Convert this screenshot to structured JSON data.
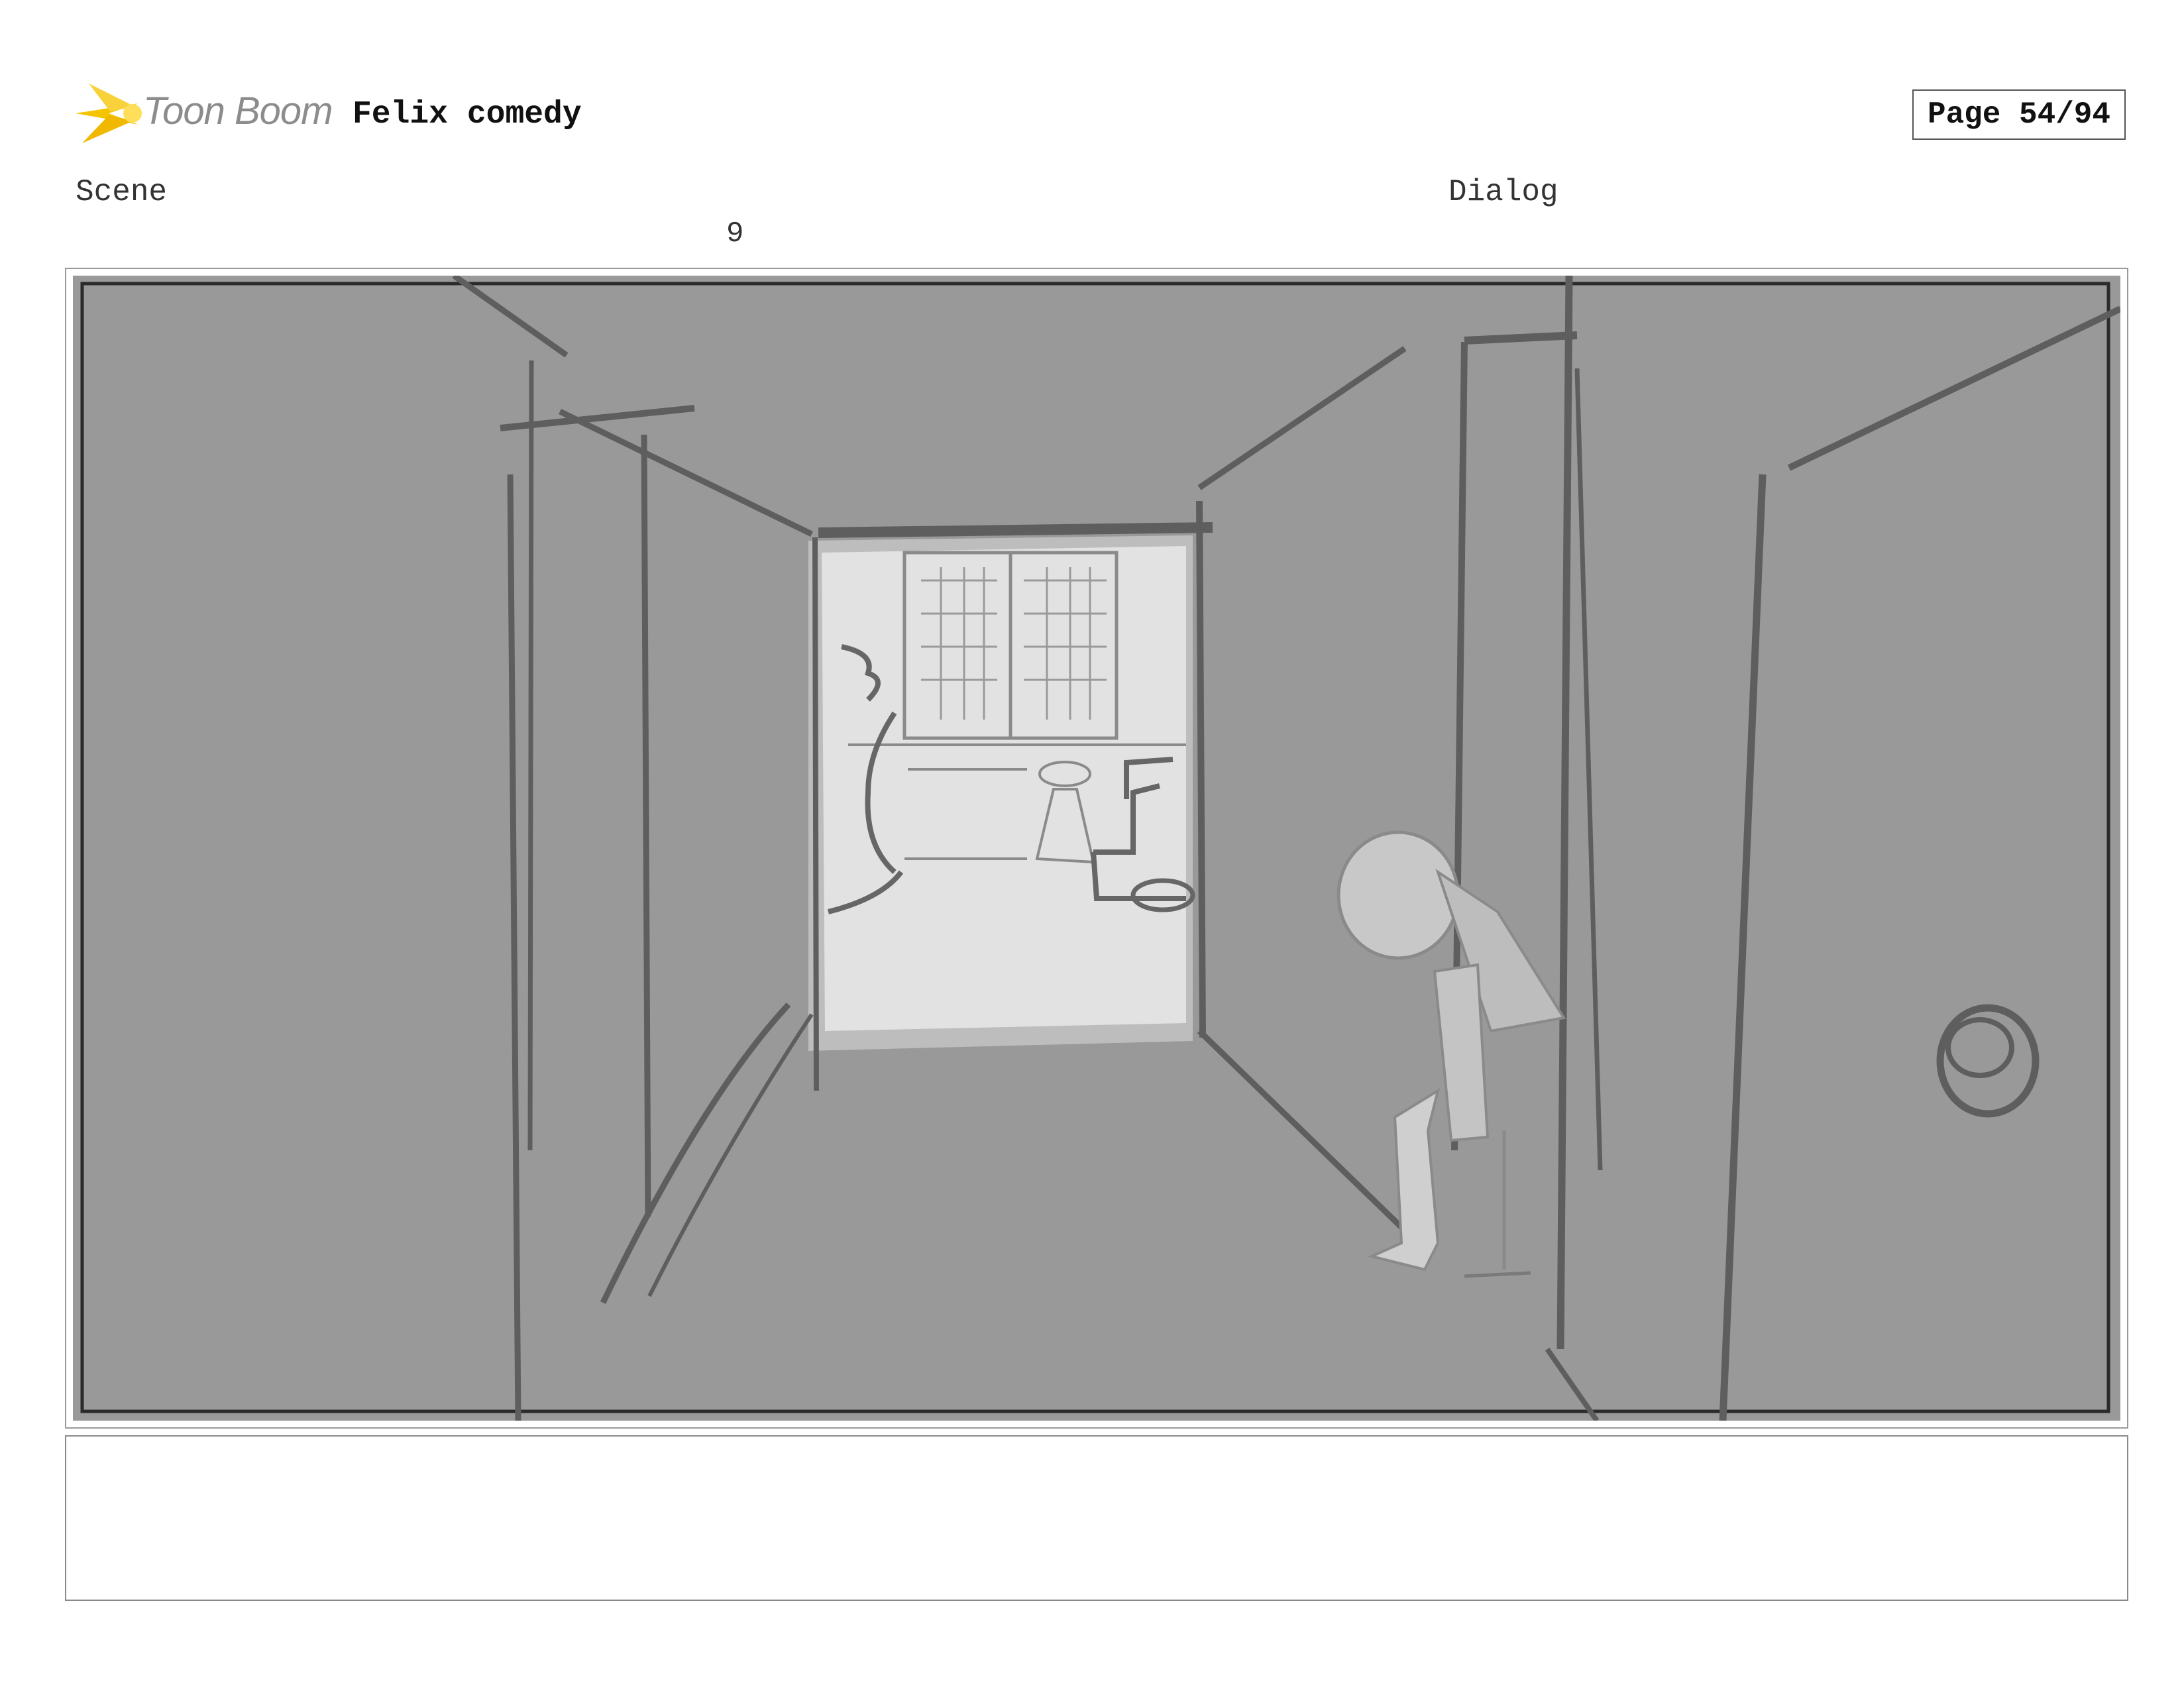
{
  "header": {
    "logo_text": "Toon Boom",
    "project_title": "Felix comedy",
    "page_label": "Page 54/94"
  },
  "panel": {
    "scene_label": "Scene",
    "dialog_label": "Dialog",
    "scene_number": "9",
    "dialog_text": ""
  },
  "colors": {
    "sketch_background": "#999999",
    "doorway_light": "#e2e2e2",
    "line_dark": "#5e5e5e",
    "logo_yellow": "#f5c400"
  }
}
